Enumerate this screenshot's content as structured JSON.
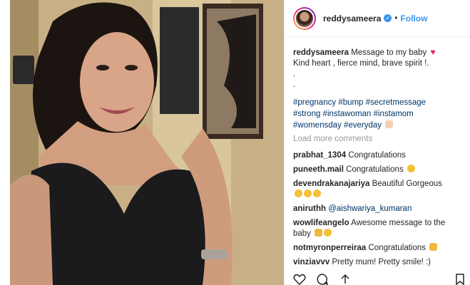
{
  "post": {
    "username": "reddysameera",
    "follow_label": "Follow",
    "dot": "•",
    "verified_glyph": "✓"
  },
  "caption": {
    "author": "reddysameera",
    "text": "Message to my baby",
    "line2": "Kind heart , fierce mind, brave spirit !.",
    "dot1": ".",
    "dot2": ".",
    "hashtags_line1": "#pregnancy #bump #secretmessage",
    "hashtags_line2": "#strong #instawoman #instamom",
    "hashtags_line3": "#womensday #everyday"
  },
  "load_more": "Load more comments",
  "comments": [
    {
      "user": "prabhat_1304",
      "text": "Congratulations"
    },
    {
      "user": "puneeth.mail",
      "text": "Congratulations"
    },
    {
      "user": "devendrakanajariya",
      "text": "Beautiful Gorgeous"
    },
    {
      "user": "aniruthh",
      "mention": "@aishwariya_kumaran"
    },
    {
      "user": "wowlifeangelo",
      "text": "Awesome message to the",
      "text2": "baby"
    },
    {
      "user": "notmyronperreiraa",
      "text": "Congratulations"
    },
    {
      "user": "vinziavvv",
      "text": "Pretty mum! Pretty smile! :)"
    }
  ],
  "icons": {
    "like": "heart-outline-icon",
    "comment": "comment-bubble-icon",
    "share": "share-icon",
    "save": "bookmark-icon"
  },
  "colors": {
    "link_blue": "#3897f0",
    "hashtag": "#003569",
    "muted": "#999999",
    "heart_red": "#e0245e"
  }
}
